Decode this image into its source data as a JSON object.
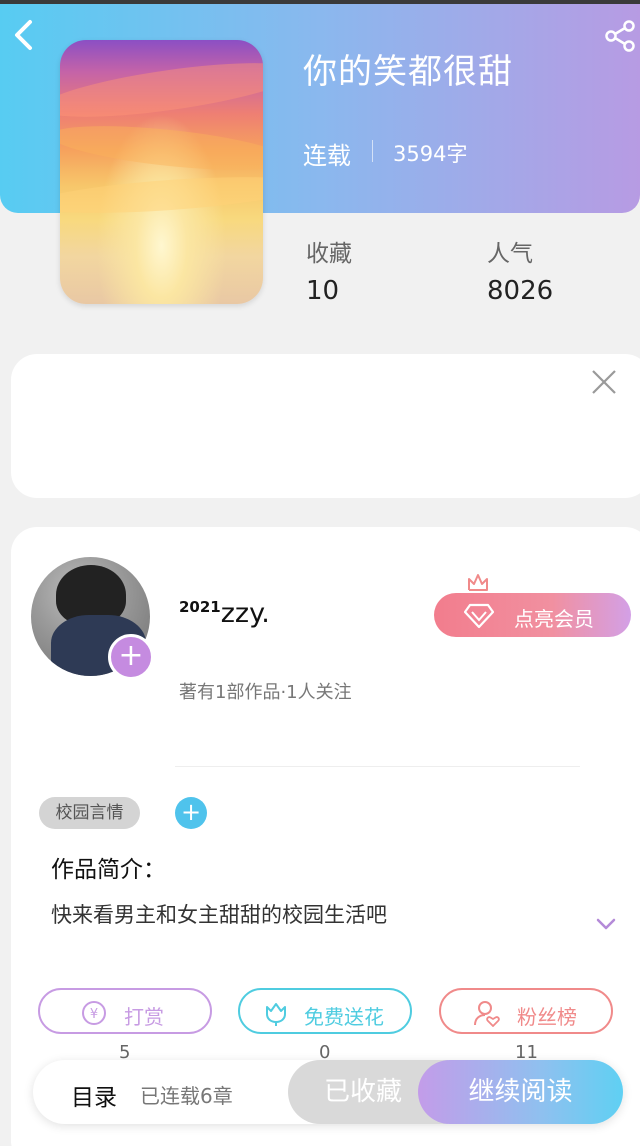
{
  "book": {
    "title": "你的笑都很甜",
    "status": "连载",
    "word_count": "3594字",
    "stats": [
      {
        "label": "收藏",
        "value": "10"
      },
      {
        "label": "人气",
        "value": "8026"
      }
    ]
  },
  "author": {
    "name_sup": "2021",
    "name": "zzy.",
    "meta": "著有1部作品·1人关注",
    "vip_label": "点亮会员"
  },
  "tags": [
    "校园言情"
  ],
  "intro": {
    "title": "作品简介：",
    "text": "快来看男主和女主甜甜的校园生活吧"
  },
  "actions": [
    {
      "label": "打赏",
      "count": "5",
      "color": "#c79be3",
      "icon": "yen-coin-icon"
    },
    {
      "label": "免费送花",
      "count": "0",
      "color": "#4fcce0",
      "icon": "flower-icon"
    },
    {
      "label": "粉丝榜",
      "count": "11",
      "color": "#f08a8a",
      "icon": "fan-rank-icon"
    }
  ],
  "bottom": {
    "toc_label": "目录",
    "toc_sub": "已连载6章",
    "fav_label": "已收藏",
    "read_label": "继续阅读"
  }
}
